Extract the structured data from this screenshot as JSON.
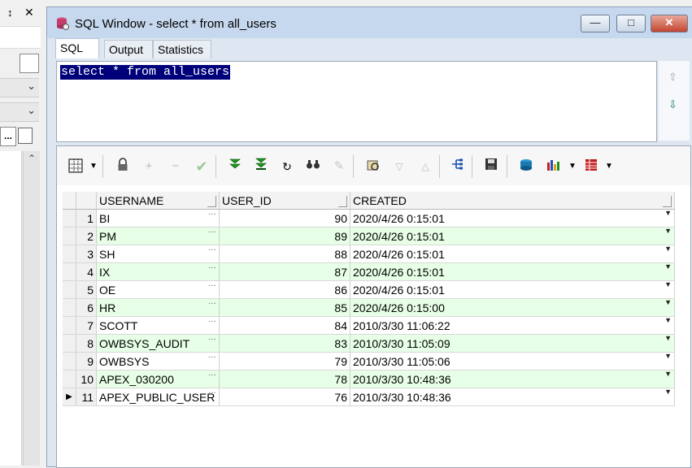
{
  "left_panel": {
    "pin_icon": "pin-icon",
    "close_icon": "close-icon",
    "dots_label": "..."
  },
  "window": {
    "title": "SQL Window - select * from all_users",
    "minimize_glyph": "—",
    "maximize_glyph": "□",
    "close_glyph": "✕"
  },
  "tabs": [
    {
      "label": "SQL",
      "active": true
    },
    {
      "label": "Output",
      "active": false
    },
    {
      "label": "Statistics",
      "active": false
    }
  ],
  "editor": {
    "query": "select * from all_users"
  },
  "toolbar_icons": [
    "grid-select-icon",
    "lock-icon",
    "add-record-icon",
    "delete-record-icon",
    "post-changes-icon",
    "fetch-next-icon",
    "fetch-last-icon",
    "refresh-icon",
    "find-icon",
    "clear-icon",
    "query-by-example-icon",
    "previous-query-icon",
    "next-query-icon",
    "link-icon",
    "save-icon",
    "export-icon",
    "chart-icon",
    "table-view-icon"
  ],
  "grid": {
    "columns": [
      "USERNAME",
      "USER_ID",
      "CREATED"
    ],
    "rows": [
      {
        "n": "1",
        "username": "BI",
        "user_id": "90",
        "created": "2020/4/26 0:15:01"
      },
      {
        "n": "2",
        "username": "PM",
        "user_id": "89",
        "created": "2020/4/26 0:15:01"
      },
      {
        "n": "3",
        "username": "SH",
        "user_id": "88",
        "created": "2020/4/26 0:15:01"
      },
      {
        "n": "4",
        "username": "IX",
        "user_id": "87",
        "created": "2020/4/26 0:15:01"
      },
      {
        "n": "5",
        "username": "OE",
        "user_id": "86",
        "created": "2020/4/26 0:15:01"
      },
      {
        "n": "6",
        "username": "HR",
        "user_id": "85",
        "created": "2020/4/26 0:15:00"
      },
      {
        "n": "7",
        "username": "SCOTT",
        "user_id": "84",
        "created": "2010/3/30 11:06:22"
      },
      {
        "n": "8",
        "username": "OWBSYS_AUDIT",
        "user_id": "83",
        "created": "2010/3/30 11:05:09"
      },
      {
        "n": "9",
        "username": "OWBSYS",
        "user_id": "79",
        "created": "2010/3/30 11:05:06"
      },
      {
        "n": "10",
        "username": "APEX_030200",
        "user_id": "78",
        "created": "2010/3/30 10:48:36"
      },
      {
        "n": "11",
        "username": "APEX_PUBLIC_USER",
        "user_id": "76",
        "created": "2010/3/30 10:48:36"
      }
    ],
    "current_row": 11,
    "alt_row_color": "#e6ffe6"
  }
}
